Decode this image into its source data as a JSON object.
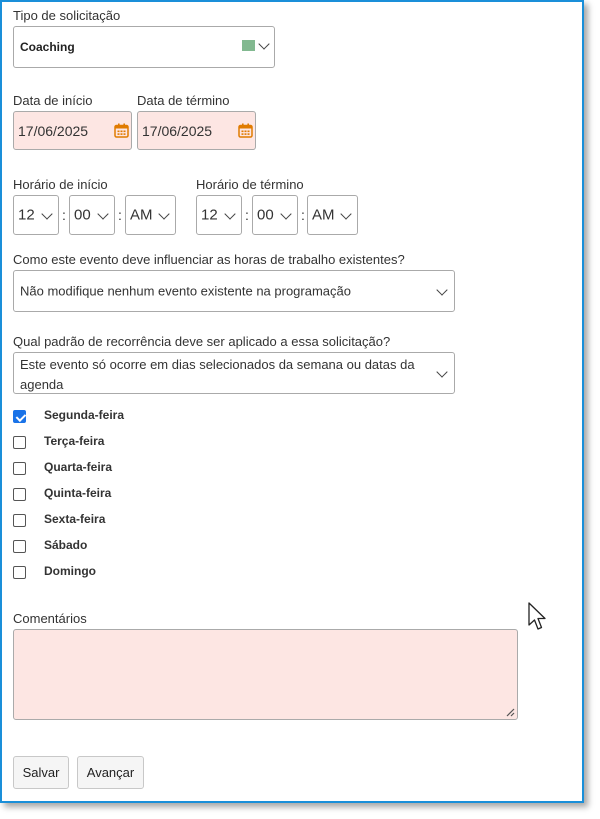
{
  "tipo": {
    "label": "Tipo de solicitação",
    "value": "Coaching",
    "swatch_color": "#82b990"
  },
  "datas": {
    "inicio_label": "Data de início",
    "inicio_value": "17/06/2025",
    "termino_label": "Data de término",
    "termino_value": "17/06/2025",
    "icon": "calendar-icon"
  },
  "horario_inicio": {
    "label": "Horário de início",
    "hour": "12",
    "minute": "00",
    "ampm": "AM"
  },
  "horario_termino": {
    "label": "Horário de término",
    "hour": "12",
    "minute": "00",
    "ampm": "AM"
  },
  "separador": ":",
  "influencia": {
    "label": "Como este evento deve influenciar as horas de trabalho existentes?",
    "value": "Não modifique nenhum evento existente na programação"
  },
  "recorrencia": {
    "label": "Qual padrão de recorrência deve ser aplicado a essa solicitação?",
    "value": "Este evento só ocorre em dias selecionados da semana ou datas da agenda"
  },
  "dias": [
    {
      "label": "Segunda-feira",
      "checked": true
    },
    {
      "label": "Terça-feira",
      "checked": false
    },
    {
      "label": "Quarta-feira",
      "checked": false
    },
    {
      "label": "Quinta-feira",
      "checked": false
    },
    {
      "label": "Sexta-feira",
      "checked": false
    },
    {
      "label": "Sábado",
      "checked": false
    },
    {
      "label": "Domingo",
      "checked": false
    }
  ],
  "comentarios": {
    "label": "Comentários",
    "value": ""
  },
  "botoes": {
    "salvar": "Salvar",
    "avancar": "Avançar"
  },
  "colors": {
    "frame": "#1a8fd9",
    "field_pink": "#fde6e3",
    "calendar": "#e07b00",
    "check": "#1a73e8"
  }
}
